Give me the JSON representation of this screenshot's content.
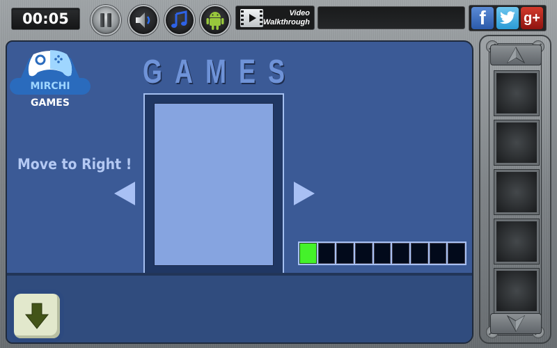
{
  "topbar": {
    "timer": "00:05",
    "buttons": {
      "pause": "pause-icon",
      "sound": "speaker-icon",
      "music": "music-note-icon",
      "android": "android-icon"
    },
    "video_walkthrough": {
      "line1": "Video",
      "line2": "Walkthrough"
    },
    "message": "",
    "social": {
      "facebook": "f",
      "twitter": "t",
      "google_plus": "g+"
    }
  },
  "scene": {
    "logo": {
      "word1": "MIRCHI",
      "word2": "GAMES"
    },
    "title": "GAMES",
    "hint": "Move to Right !",
    "progress": {
      "total_cells": 9,
      "filled_cells": 1,
      "filled_color": "#44f22a",
      "empty_color": "#020a1b"
    },
    "down_button": "arrow-down-icon"
  },
  "inventory": {
    "slot_count": 5,
    "slots": [
      "",
      "",
      "",
      "",
      ""
    ]
  },
  "colors": {
    "panel": "#3b5a96",
    "floor": "#304c7e",
    "door": "#86a4e0",
    "accent_light": "#a8c0f4"
  }
}
